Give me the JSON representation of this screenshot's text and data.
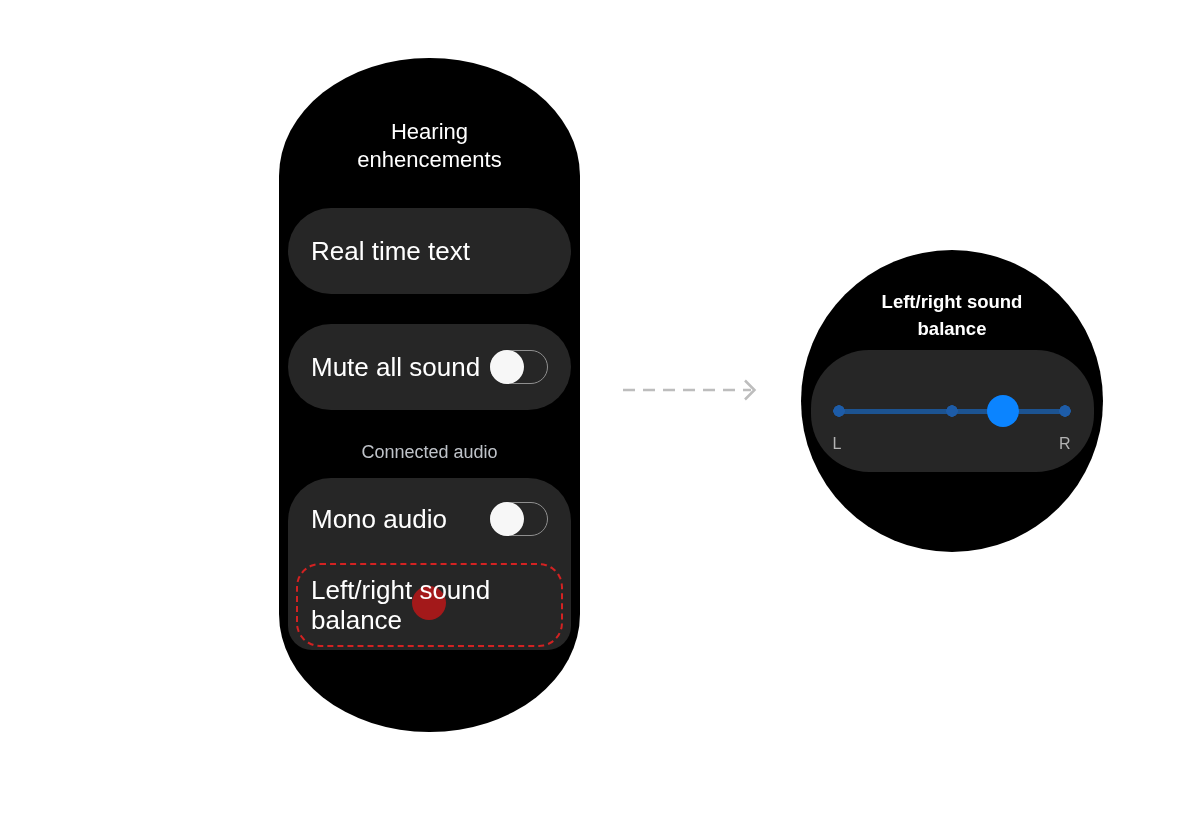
{
  "main_screen": {
    "title": "Hearing enhencements",
    "items": [
      {
        "kind": "link",
        "label": "Real time text"
      },
      {
        "kind": "toggle",
        "label": "Mute all sound",
        "on": false
      }
    ],
    "section_header": "Connected audio",
    "section_items": [
      {
        "kind": "toggle",
        "label": "Mono audio",
        "on": false,
        "highlighted": false,
        "tapped": false
      },
      {
        "kind": "link",
        "label": "Left/right sound balance",
        "highlighted": true,
        "tapped": true
      }
    ]
  },
  "detail_screen": {
    "title": "Left/right sound balance",
    "slider": {
      "level": 0.73,
      "min_label": "L",
      "max_label": "R"
    }
  }
}
